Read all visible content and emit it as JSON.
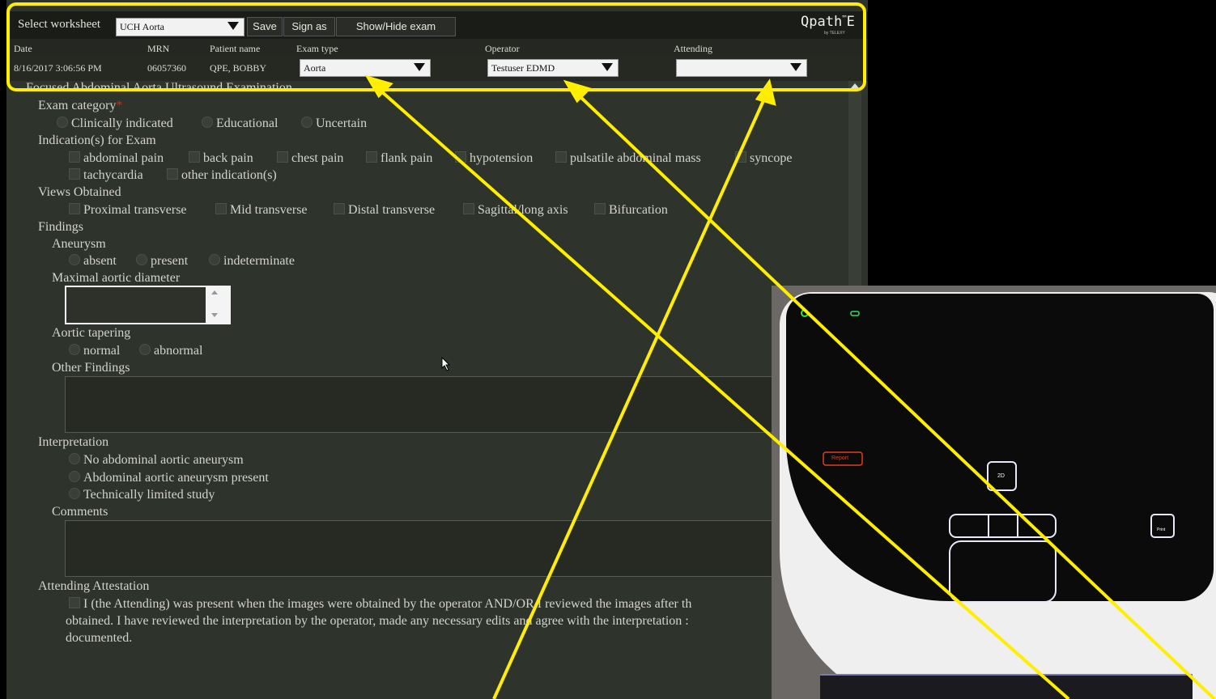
{
  "toolbar": {
    "select_label": "Select worksheet",
    "worksheet_value": "UCH Aorta",
    "save_label": "Save",
    "sign_as_label": "Sign as",
    "show_hide_label": "Show/Hide exam",
    "brand": "Qpath",
    "brand_suffix": "E",
    "brand_sub": "by TELEXY"
  },
  "header": {
    "date_label": "Date",
    "mrn_label": "MRN",
    "patient_label": "Patient name",
    "exam_type_label": "Exam type",
    "operator_label": "Operator",
    "attending_label": "Attending",
    "date_value": "8/16/2017 3:06:56 PM",
    "mrn_value": "06057360",
    "patient_value": "QPE, BOBBY",
    "exam_type_value": "Aorta",
    "operator_value": "Testuser EDMD",
    "attending_value": ""
  },
  "form": {
    "title": "Focused Abdominal Aorta Ultrasound Examination",
    "exam_category_label": "Exam category",
    "required_mark": "*",
    "exam_category_options": [
      "Clinically indicated",
      "Educational",
      "Uncertain"
    ],
    "indications_label": "Indication(s) for Exam",
    "indications_row1": [
      "abdominal pain",
      "back pain",
      "chest pain",
      "flank pain",
      "hypotension",
      "pulsatile abdominal mass",
      "syncope"
    ],
    "indications_row2": [
      "tachycardia",
      "other indication(s)"
    ],
    "views_label": "Views Obtained",
    "views": [
      "Proximal transverse",
      "Mid transverse",
      "Distal transverse",
      "Sagittal/long axis",
      "Bifurcation"
    ],
    "findings_label": "Findings",
    "aneurysm_label": "Aneurysm",
    "aneurysm_options": [
      "absent",
      "present",
      "indeterminate"
    ],
    "diameter_label": "Maximal aortic diameter",
    "tapering_label": "Aortic tapering",
    "tapering_options": [
      "normal",
      "abnormal"
    ],
    "other_findings_label": "Other Findings",
    "interpretation_label": "Interpretation",
    "interpretation_options": [
      "No abdominal aortic aneurysm",
      "Abdominal aortic aneurysm present",
      "Technically limited study"
    ],
    "comments_label": "Comments",
    "attestation_label": "Attending Attestation",
    "attestation_line1": "I (the Attending) was present when the images were obtained by the operator AND/OR I reviewed the images after th",
    "attestation_line2": "obtained. I have reviewed the interpretation by the operator, made any necessary edits and agree with the interpretation :",
    "attestation_line3": "documented."
  },
  "device": {
    "report_label": "Report",
    "mode_label": "2D",
    "print_label": "Print"
  },
  "colors": {
    "highlight": "#ffee00",
    "background": "#2e332b",
    "required": "#e02020"
  }
}
